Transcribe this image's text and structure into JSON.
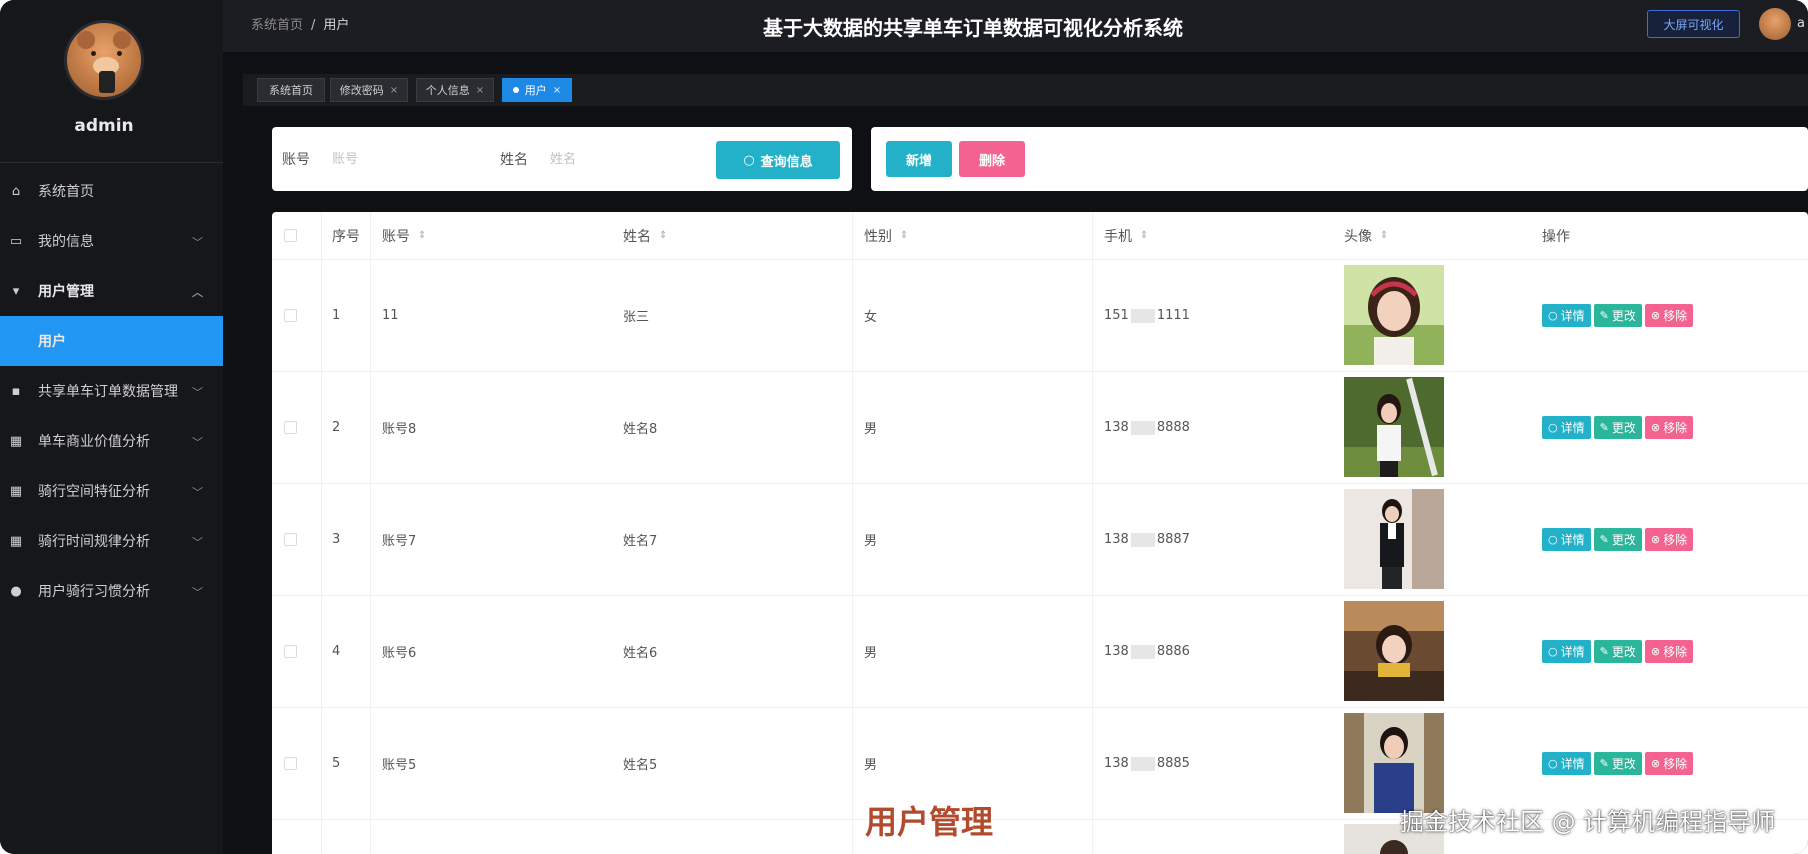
{
  "sidebar": {
    "username": "admin",
    "items": [
      {
        "label": "系统首页",
        "icon": "home-icon",
        "glyph": "⌂"
      },
      {
        "label": "我的信息",
        "icon": "card-icon",
        "glyph": "▭"
      },
      {
        "label": "用户管理",
        "icon": "user-manage-icon",
        "glyph": "▾"
      },
      {
        "label": "用户"
      },
      {
        "label": "共享单车订单数据管理",
        "icon": "comment-icon",
        "glyph": "▪"
      },
      {
        "label": "单车商业价值分析",
        "icon": "grid-icon",
        "glyph": "▦"
      },
      {
        "label": "骑行空间特征分析",
        "icon": "grid-icon",
        "glyph": "▦"
      },
      {
        "label": "骑行时间规律分析",
        "icon": "grid-icon",
        "glyph": "▦"
      },
      {
        "label": "用户骑行习惯分析",
        "icon": "person-icon",
        "glyph": "●"
      }
    ]
  },
  "header": {
    "breadcrumb_home": "系统首页",
    "breadcrumb_sep": "/",
    "breadcrumb_current": "用户",
    "title": "基于大数据的共享单车订单数据可视化分析系统",
    "bigscreen_label": "大屏可视化",
    "user_short": "a"
  },
  "tabs": [
    {
      "label": "系统首页",
      "close": ""
    },
    {
      "label": "修改密码",
      "close": "×"
    },
    {
      "label": "个人信息",
      "close": "×"
    },
    {
      "label": "用户",
      "close": "×"
    }
  ],
  "search": {
    "account_label": "账号",
    "account_placeholder": "账号",
    "name_label": "姓名",
    "name_placeholder": "姓名",
    "button_label": "查询信息"
  },
  "actions": {
    "add_label": "新增",
    "delete_label": "删除"
  },
  "table": {
    "headers": {
      "index": "序号",
      "account": "账号",
      "name": "姓名",
      "gender": "性别",
      "phone": "手机",
      "avatar": "头像",
      "ops": "操作"
    },
    "rows": [
      {
        "index": "1",
        "account": "11",
        "name": "张三",
        "gender": "女",
        "phone_prefix": "151",
        "phone_suffix": "1111"
      },
      {
        "index": "2",
        "account": "账号8",
        "name": "姓名8",
        "gender": "男",
        "phone_prefix": "138",
        "phone_suffix": "8888"
      },
      {
        "index": "3",
        "account": "账号7",
        "name": "姓名7",
        "gender": "男",
        "phone_prefix": "138",
        "phone_suffix": "8887"
      },
      {
        "index": "4",
        "account": "账号6",
        "name": "姓名6",
        "gender": "男",
        "phone_prefix": "138",
        "phone_suffix": "8886"
      },
      {
        "index": "5",
        "account": "账号5",
        "name": "姓名5",
        "gender": "男",
        "phone_prefix": "138",
        "phone_suffix": "8885"
      }
    ],
    "op_labels": {
      "detail": "详情",
      "edit": "更改",
      "remove": "移除"
    }
  },
  "overlay": {
    "caption": "用户管理",
    "watermark": "掘金技术社区 @ 计算机编程指导师"
  },
  "colors": {
    "accent_blue": "#1e88e5",
    "teal": "#22b1c8",
    "pink": "#f4628f",
    "green": "#2bb59a"
  }
}
